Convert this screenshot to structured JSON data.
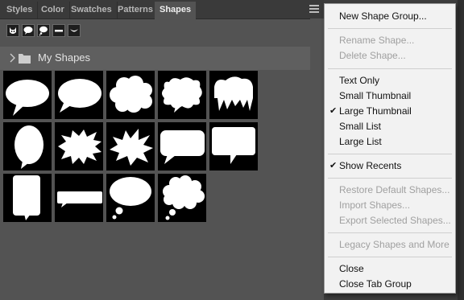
{
  "panel": {
    "tabs": [
      {
        "label": "Styles"
      },
      {
        "label": "Color"
      },
      {
        "label": "Swatches"
      },
      {
        "label": "Patterns"
      },
      {
        "label": "Shapes",
        "active": true
      }
    ],
    "group": {
      "label": "My Shapes",
      "expanded": false
    },
    "view_buttons": [
      "cat-icon",
      "speech-bubble-icon",
      "thought-bubble-icon",
      "dash-icon",
      "smile-curve-icon"
    ],
    "shapes": [
      "oval-speech-bubble",
      "wide-oval-speech-bubble",
      "cloud-speech-bubble",
      "wavy-cloud-bubble",
      "dripping-bubble",
      "tall-oval-bubble",
      "spiky-burst-bubble",
      "explosion-bubble",
      "rounded-rect-speech-bubble",
      "square-speech-bubble",
      "tall-rect-speech-bubble",
      "banner-bubble",
      "oval-thought-bubble",
      "cloud-thought-bubble"
    ]
  },
  "menu": {
    "items": [
      {
        "label": "New Shape Group...",
        "enabled": true
      },
      {
        "sep": true
      },
      {
        "label": "Rename Shape...",
        "enabled": false
      },
      {
        "label": "Delete Shape...",
        "enabled": false
      },
      {
        "sep": true
      },
      {
        "label": "Text Only",
        "enabled": true
      },
      {
        "label": "Small Thumbnail",
        "enabled": true
      },
      {
        "label": "Large Thumbnail",
        "enabled": true,
        "checked": true
      },
      {
        "label": "Small List",
        "enabled": true
      },
      {
        "label": "Large List",
        "enabled": true
      },
      {
        "sep": true
      },
      {
        "label": "Show Recents",
        "enabled": true,
        "checked": true
      },
      {
        "sep": true
      },
      {
        "label": "Restore Default Shapes...",
        "enabled": false
      },
      {
        "label": "Import Shapes...",
        "enabled": false
      },
      {
        "label": "Export Selected Shapes...",
        "enabled": false
      },
      {
        "sep": true
      },
      {
        "label": "Legacy Shapes and More",
        "enabled": false
      },
      {
        "sep": true
      },
      {
        "label": "Close",
        "enabled": true
      },
      {
        "label": "Close Tab Group",
        "enabled": true
      }
    ],
    "check_glyph": "✔"
  }
}
